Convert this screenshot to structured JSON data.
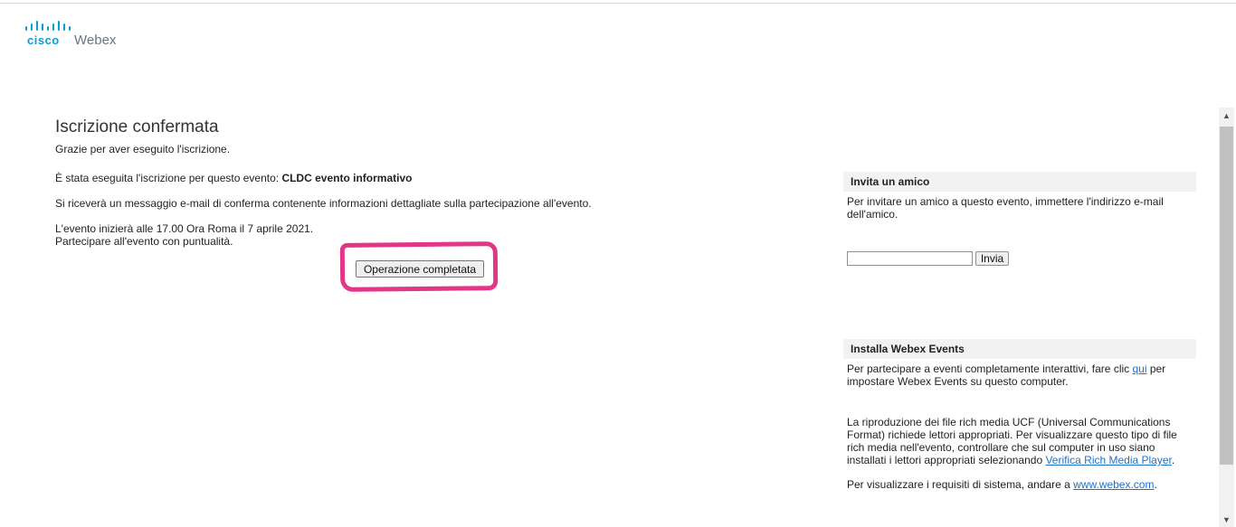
{
  "logo": {
    "cisco_text": "cisco",
    "product_text": "Webex",
    "color": "#049fd9"
  },
  "main": {
    "title": "Iscrizione confermata",
    "thanks": "Grazie per aver eseguito l'iscrizione.",
    "registered_prefix": "È stata eseguita l'iscrizione per questo evento: ",
    "event_name": "CLDC evento informativo",
    "confirmation_email": "Si riceverà un messaggio e-mail di conferma contenente informazioni dettagliate sulla partecipazione all'evento.",
    "start_time": "L'evento inizierà alle 17.00 Ora Roma il 7 aprile 2021.",
    "punctuality": "Partecipare all'evento con puntualità.",
    "done_button": "Operazione completata",
    "highlight_color": "#e0207a"
  },
  "invite": {
    "header": "Invita un amico",
    "text": "Per invitare un amico a questo evento, immettere l'indirizzo e-mail dell'amico.",
    "input_value": "",
    "button": "Invia"
  },
  "install": {
    "header": "Installa Webex Events",
    "text_before": "Per partecipare a eventi completamente interattivi, fare clic ",
    "link_here": "qui",
    "text_after": " per impostare Webex Events su questo computer.",
    "rich_media_text": "La riproduzione dei file rich media UCF (Universal Communications Format) richiede lettori appropriati. Per visualizzare questo tipo di file rich media nell'evento, controllare che sul computer in uso siano installati i lettori appropriati selezionando ",
    "rich_media_link": "Verifica Rich Media Player",
    "rich_media_end": ".",
    "requirements_text": "Per visualizzare i requisiti di sistema, andare a ",
    "requirements_link": "www.webex.com",
    "requirements_end": ".",
    "link_color": "#1a73c9"
  },
  "icons": {
    "scroll_up": "▲",
    "scroll_down": "▼"
  }
}
